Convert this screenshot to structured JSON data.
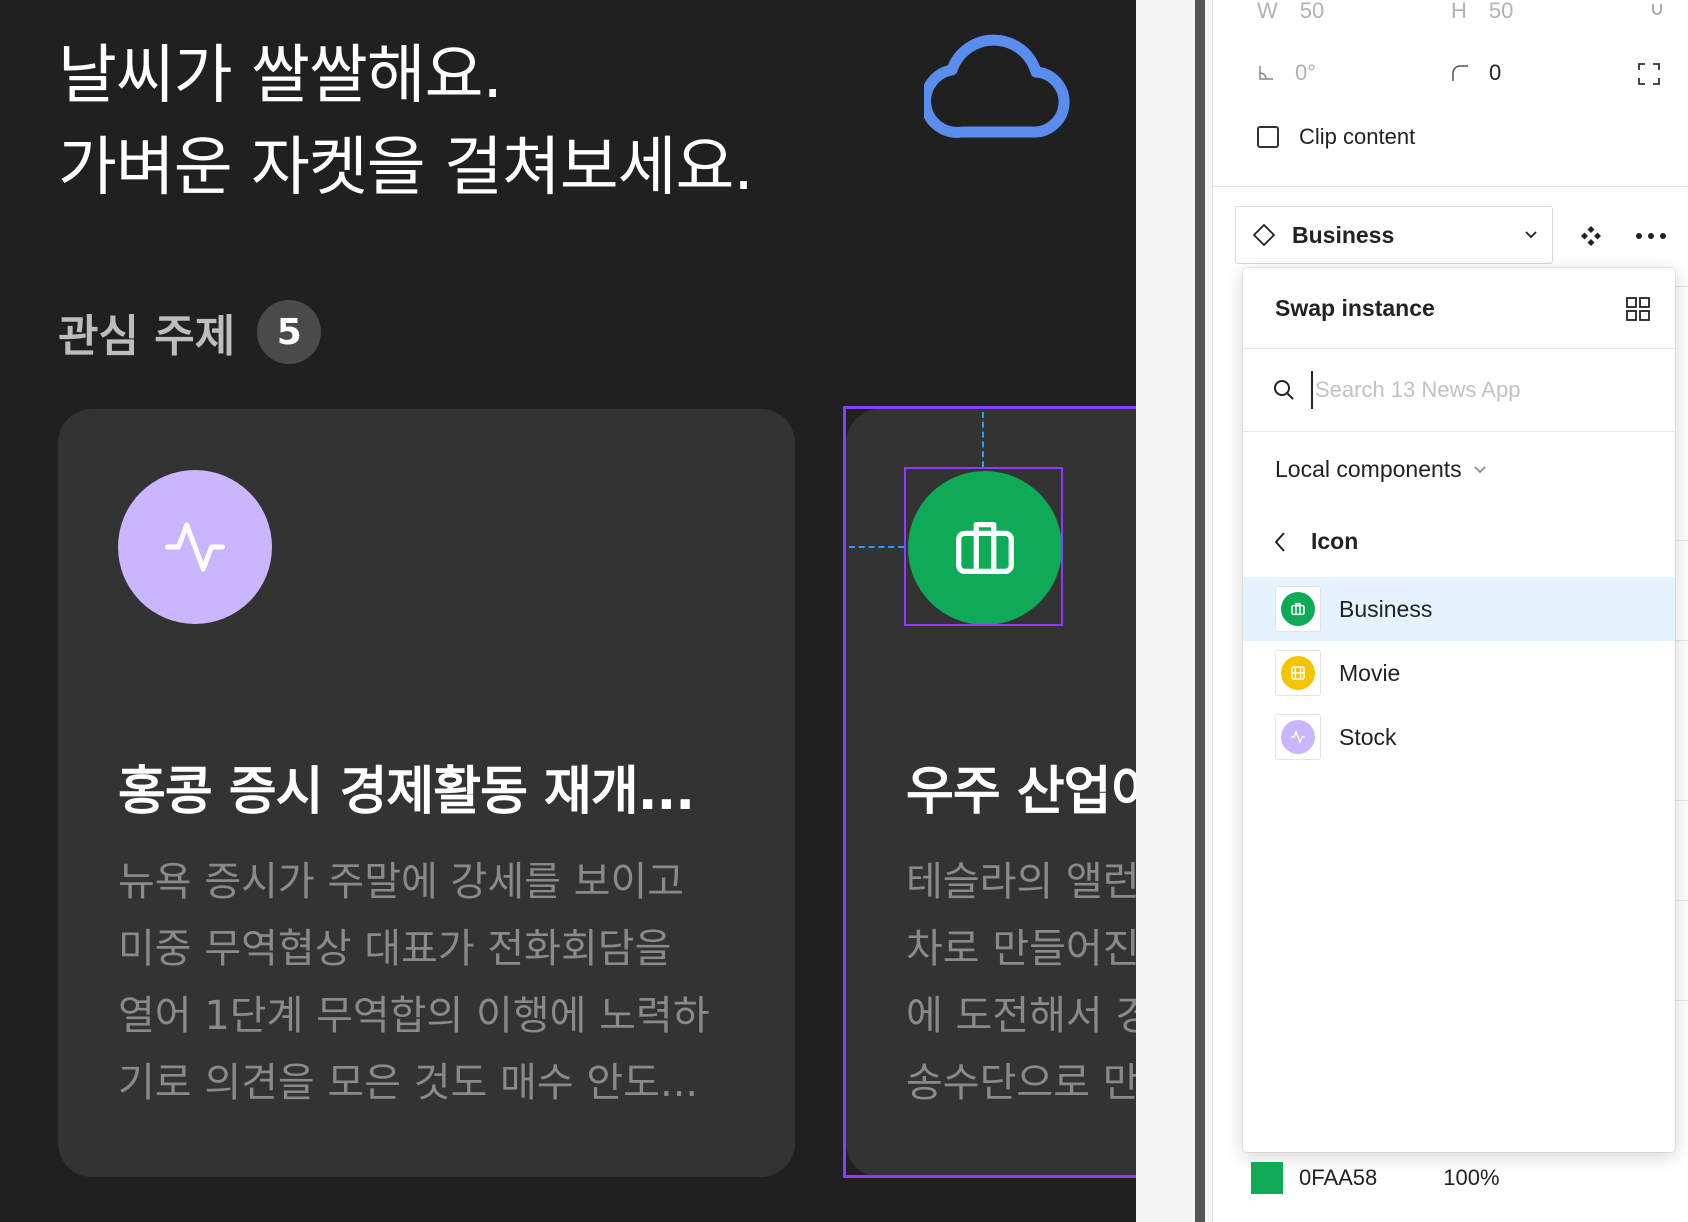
{
  "canvas": {
    "headline_line1": "날씨가 쌀쌀해요.",
    "headline_line2": "가벼운 자켓을 걸쳐보세요.",
    "weather_icon": "cloud-icon",
    "topics_label": "관심 주제",
    "topics_count": "5",
    "cards": [
      {
        "icon": "activity-icon",
        "icon_color": "#C9B6FF",
        "title": "홍콩 증시 경제활동 재개...",
        "body": [
          "뉴욕 증시가 주말에 강세를 보이고",
          "미중 무역협상 대표가 전화회담을",
          "열어 1단계 무역합의 이행에 노력하",
          "기로 의견을 모은 것도 매수 안도..."
        ]
      },
      {
        "icon": "briefcase-icon",
        "icon_color": "#0FAA58",
        "title": "우주 산업이",
        "body": [
          "테슬라의 앨런",
          "차로 만들어진",
          "에 도전해서 경",
          "송수단으로 만"
        ]
      }
    ]
  },
  "panel": {
    "w_label": "W",
    "w_value": "50",
    "h_label": "H",
    "h_value": "50",
    "rotation": "0°",
    "radius": "0",
    "clip_content": "Clip content",
    "instance_name": "Business",
    "swap": {
      "title": "Swap instance",
      "search_placeholder": "Search 13 News App",
      "library": "Local components",
      "group": "Icon",
      "items": [
        {
          "label": "Business",
          "color": "#0FAA58",
          "icon": "briefcase-icon"
        },
        {
          "label": "Movie",
          "color": "#F5C400",
          "icon": "film-icon"
        },
        {
          "label": "Stock",
          "color": "#C9B6FF",
          "icon": "activity-icon"
        }
      ]
    },
    "fill_hex": "0FAA58",
    "fill_opacity": "100%"
  },
  "colors": {
    "accent": "#8D3CFF",
    "guide": "#2B9BFF",
    "cloud": "#5B8DEF",
    "selected_row": "#E5F3FE"
  }
}
